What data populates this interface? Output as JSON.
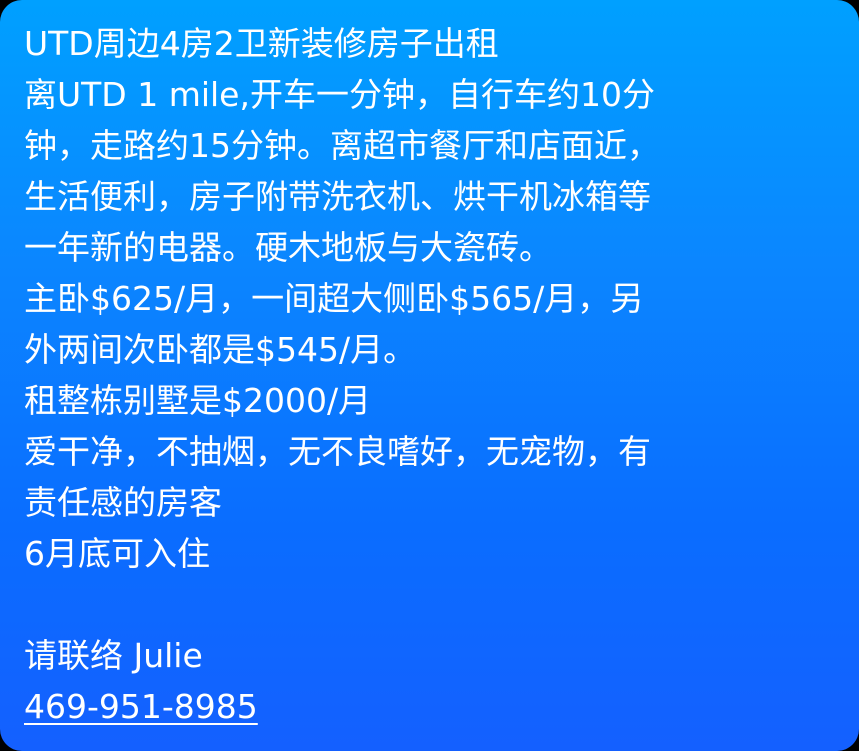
{
  "message": {
    "lines": [
      "UTD周边4房2卫新装修房子出租",
      "离UTD 1 mile,开车一分钟，自行车约10分",
      "钟，走路约15分钟。离超市餐厅和店面近，",
      "生活便利，房子附带洗衣机、烘干机冰箱等",
      "一年新的电器。硬木地板与大瓷砖。",
      "主卧$625/月，一间超大侧卧$565/月，另",
      "外两间次卧都是$545/月。",
      "租整栋别墅是$2000/月",
      "爱干净，不抽烟，无不良嗜好，无宠物，有",
      "责任感的房客",
      "6月底可入住"
    ],
    "contact": "请联络 Julie",
    "phone": "469-951-8985"
  },
  "colors": {
    "bubble_top": "#00a0ff",
    "bubble_bottom": "#1460ff",
    "text": "#ffffff"
  }
}
